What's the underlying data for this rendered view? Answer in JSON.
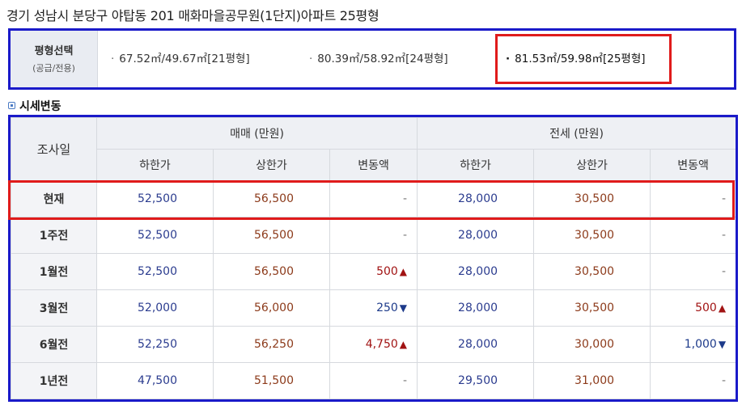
{
  "title": "경기 성남시 분당구 야탑동 201 매화마을공무원(1단지)아파트 25평형",
  "size_select": {
    "label": "평형선택",
    "sublabel": "(공급/전용)",
    "options": [
      {
        "text": "67.52㎡/49.67㎡[21평형]",
        "active": false
      },
      {
        "text": "80.39㎡/58.92㎡[24평형]",
        "active": false
      },
      {
        "text": "81.53㎡/59.98㎡[25평형]",
        "active": true
      }
    ],
    "bullet": "·"
  },
  "section": {
    "title": "시세변동"
  },
  "table": {
    "date_header": "조사일",
    "groups": [
      "매매 (만원)",
      "전세 (만원)"
    ],
    "subheaders": [
      "하한가",
      "상한가",
      "변동액",
      "하한가",
      "상한가",
      "변동액"
    ],
    "rows": [
      {
        "date": "현재",
        "sale_low": "52,500",
        "sale_high": "56,500",
        "sale_chg": "-",
        "sale_dir": "",
        "rent_low": "28,000",
        "rent_high": "30,500",
        "rent_chg": "-",
        "rent_dir": ""
      },
      {
        "date": "1주전",
        "sale_low": "52,500",
        "sale_high": "56,500",
        "sale_chg": "-",
        "sale_dir": "",
        "rent_low": "28,000",
        "rent_high": "30,500",
        "rent_chg": "-",
        "rent_dir": ""
      },
      {
        "date": "1월전",
        "sale_low": "52,500",
        "sale_high": "56,500",
        "sale_chg": "500",
        "sale_dir": "up",
        "rent_low": "28,000",
        "rent_high": "30,500",
        "rent_chg": "-",
        "rent_dir": ""
      },
      {
        "date": "3월전",
        "sale_low": "52,000",
        "sale_high": "56,000",
        "sale_chg": "250",
        "sale_dir": "down",
        "rent_low": "28,000",
        "rent_high": "30,500",
        "rent_chg": "500",
        "rent_dir": "up"
      },
      {
        "date": "6월전",
        "sale_low": "52,250",
        "sale_high": "56,250",
        "sale_chg": "4,750",
        "sale_dir": "up",
        "rent_low": "28,000",
        "rent_high": "30,000",
        "rent_chg": "1,000",
        "rent_dir": "down"
      },
      {
        "date": "1년전",
        "sale_low": "47,500",
        "sale_high": "51,500",
        "sale_chg": "-",
        "sale_dir": "",
        "rent_low": "29,500",
        "rent_high": "31,000",
        "rent_chg": "-",
        "rent_dir": ""
      }
    ],
    "arrows": {
      "up": "▲",
      "down": "▼"
    }
  },
  "colors": {
    "frame_blue": "#1a1ac9",
    "highlight_red": "#e01b1b",
    "low_price": "#2b3c8f",
    "high_price": "#8c3a1a",
    "up": "#a11313",
    "down": "#1d3a8a"
  }
}
